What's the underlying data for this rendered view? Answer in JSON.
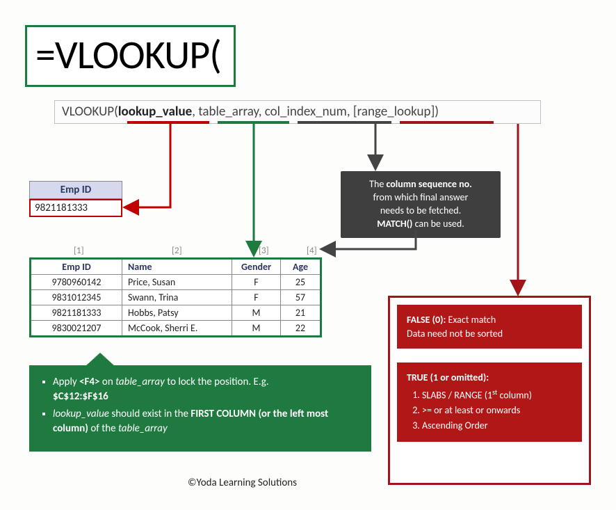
{
  "formula": "=VLOOKUP(",
  "tooltip": {
    "fn": "VLOOKUP(",
    "arg1": "lookup_value",
    "rest": ", table_array, col_index_num, [range_lookup])"
  },
  "emp_id": {
    "label": "Emp ID",
    "value": "9821181333"
  },
  "dark_callout": {
    "l1a": "The ",
    "l1b": "column sequence no.",
    "l2": "from which final answer",
    "l3": "needs to be fetched.",
    "l4a": "MATCH()",
    "l4b": " can be used."
  },
  "col_idx": {
    "c1": "[1]",
    "c2": "[2]",
    "c3": "[3]",
    "c4": "[4]"
  },
  "table": {
    "headers": {
      "a": "Emp ID",
      "b": "Name",
      "c": "Gender",
      "d": "Age"
    },
    "rows": [
      {
        "a": "9780960142",
        "b": "Price, Susan",
        "c": "F",
        "d": "25"
      },
      {
        "a": "9831012345",
        "b": "Swann, Trina",
        "c": "F",
        "d": "57"
      },
      {
        "a": "9821181333",
        "b": "Hobbs, Patsy",
        "c": "M",
        "d": "21"
      },
      {
        "a": "9830021207",
        "b": "McCook, Sherri E.",
        "c": "M",
        "d": "22"
      }
    ]
  },
  "green_tip": {
    "l1a": "Apply ",
    "l1b": "<F4>",
    "l1c": " on ",
    "l1d": "table_array",
    "l1e": " to lock the position. E.g. ",
    "l1f": "$C$12:$F$16",
    "l2a": "lookup_value",
    "l2b": " should exist in the ",
    "l2c": "FIRST COLUMN (or the left most column)",
    "l2d": " of the ",
    "l2e": "table_array"
  },
  "red_false": {
    "title": "FALSE (0):",
    "desc": " Exact match",
    "line2": "Data need not be sorted"
  },
  "red_true": {
    "title": "TRUE (1 or omitted):",
    "i1a": "SLABS / RANGE (1",
    "i1sup": "st",
    "i1b": " column)",
    "i2": ">= or at least or onwards",
    "i3": "Ascending Order"
  },
  "copyright": "©Yoda Learning Solutions"
}
